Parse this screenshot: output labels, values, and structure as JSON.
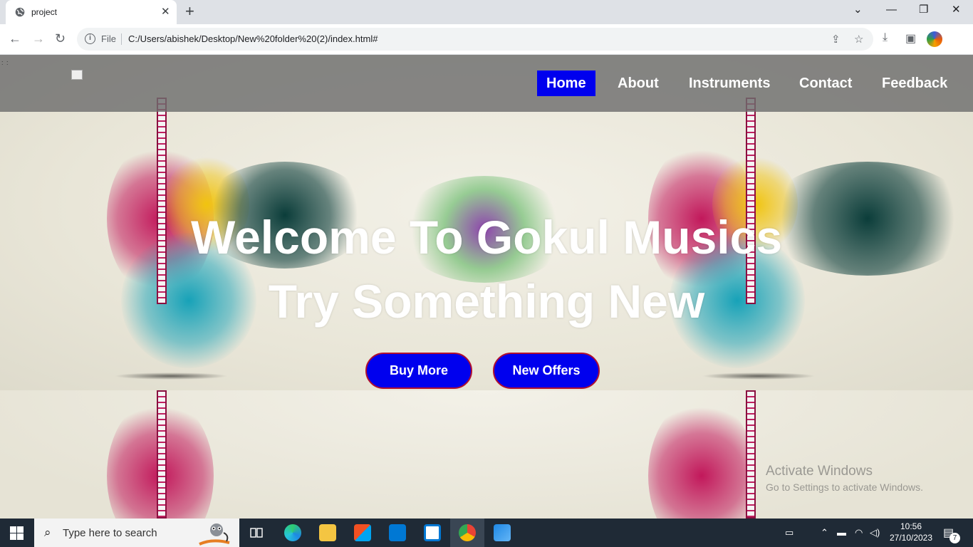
{
  "browser": {
    "tab_title": "project",
    "tab_close": "✕",
    "new_tab": "+",
    "win_min": "—",
    "win_restore": "❐",
    "win_close": "✕",
    "win_dropdown": "⌄",
    "back": "←",
    "forward": "→",
    "reload": "↻",
    "scheme_label": "File",
    "url": "C:/Users/abishek/Desktop/New%20folder%20(2)/index.html#",
    "share": "⇪",
    "bookmark": "☆",
    "download": "⤓",
    "sidepanel": "▣"
  },
  "page": {
    "dots": ": :",
    "nav": [
      {
        "label": "Home",
        "active": true
      },
      {
        "label": "About",
        "active": false
      },
      {
        "label": "Instruments",
        "active": false
      },
      {
        "label": "Contact",
        "active": false
      },
      {
        "label": "Feedback",
        "active": false
      }
    ],
    "hero_line1": "Welcome To Gokul Musics",
    "hero_line2": "Try Something New",
    "buttons": {
      "buy": "Buy More",
      "offers": "New Offers"
    },
    "accent": "#0000ee"
  },
  "watermark": {
    "line1": "Activate Windows",
    "line2": "Go to Settings to activate Windows."
  },
  "taskbar": {
    "search_placeholder": "Type here to search",
    "time": "10:56",
    "date": "27/10/2023",
    "notifications_count": "7"
  }
}
